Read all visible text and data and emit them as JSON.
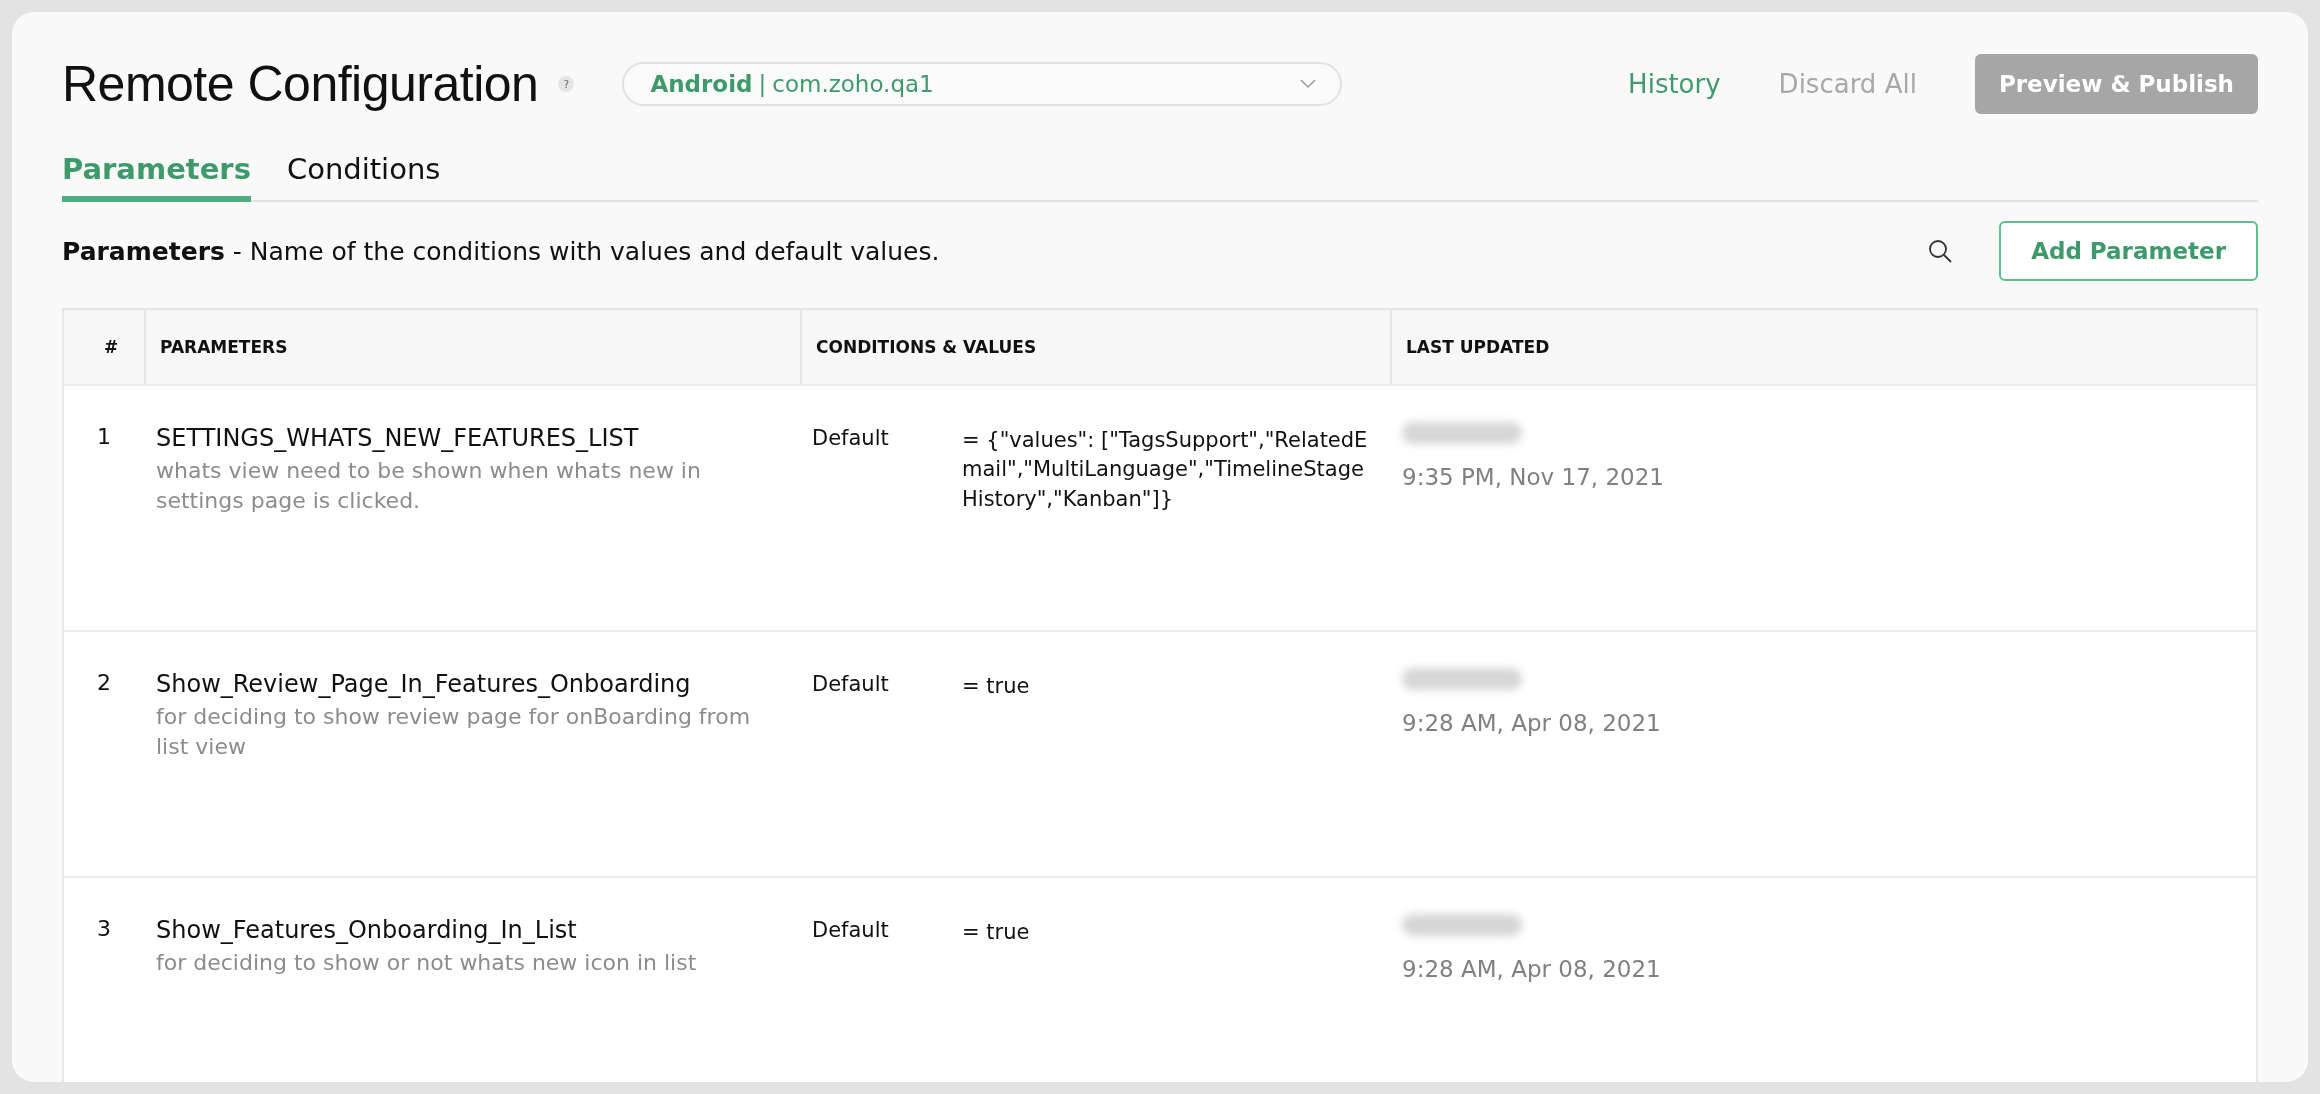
{
  "header": {
    "title": "Remote Configuration",
    "help": "?",
    "app_selector": {
      "platform": "Android",
      "separator": "|",
      "package": "com.zoho.qa1"
    },
    "links": [
      {
        "label": "History",
        "disabled": false
      },
      {
        "label": "Discard All",
        "disabled": true
      }
    ],
    "publish_button": {
      "label": "Preview & Publish",
      "disabled": true
    }
  },
  "tabs": [
    {
      "label": "Parameters",
      "selected": true
    },
    {
      "label": "Conditions",
      "selected": false
    }
  ],
  "intro": "**Parameters** - Name of the conditions with values and default values.",
  "add_button": "Add Parameter",
  "table": {
    "columns": [
      "#",
      "PARAMETERS",
      "CONDITIONS & VALUES",
      "LAST UPDATED"
    ],
    "rows": [
      {
        "index": "1",
        "name": "SETTINGS_WHATS_NEW_FEATURES_LIST",
        "description": "whats view need to be shown when whats new in settings page is clicked.",
        "condition": "Default",
        "value": "= {\"values\": [\"TagsSupport\",\"RelatedEmail\",\"MultiLanguage\",\"TimelineStageHistory\",\"Kanban\"]}",
        "updated": "9:35 PM, Nov 17, 2021"
      },
      {
        "index": "2",
        "name": "Show_Review_Page_In_Features_Onboarding",
        "description": "for deciding to show review page for onBoarding from list view",
        "condition": "Default",
        "value": "= true",
        "updated": "9:28 AM, Apr 08, 2021"
      },
      {
        "index": "3",
        "name": "Show_Features_Onboarding_In_List",
        "description": "for deciding to show or not whats new icon in list",
        "condition": "Default",
        "value": "= true",
        "updated": "9:28 AM, Apr 08, 2021"
      }
    ]
  }
}
